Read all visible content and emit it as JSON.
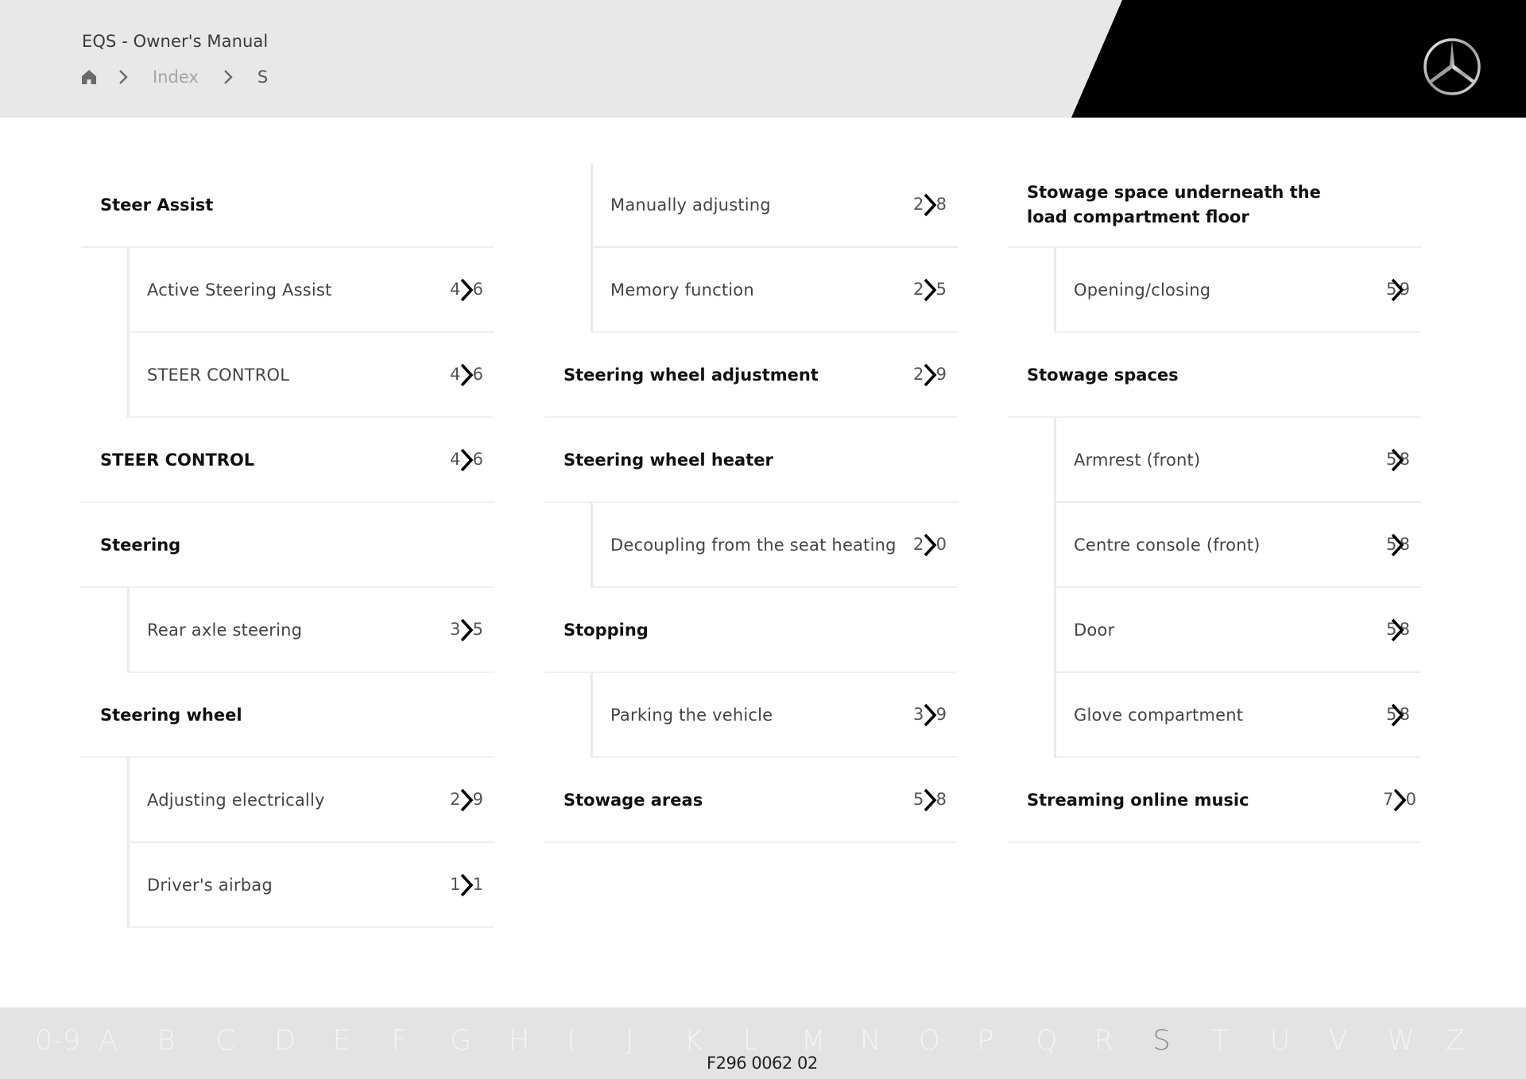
{
  "header": {
    "app_title": "EQS - Owner's Manual",
    "breadcrumb": {
      "home_icon": "home-icon",
      "items": [
        "Index",
        "S"
      ]
    },
    "logo": "mercedes-benz-star-logo"
  },
  "columns": [
    {
      "rows": [
        {
          "type": "top",
          "label": "Steer Assist"
        },
        {
          "type": "sub",
          "label": "Active Steering Assist",
          "page_first": "4",
          "page_last": "6"
        },
        {
          "type": "sub",
          "label": "STEER CONTROL",
          "page_first": "4",
          "page_last": "6"
        },
        {
          "type": "top",
          "label": "STEER CONTROL",
          "page_first": "4",
          "page_last": "6"
        },
        {
          "type": "top",
          "label": "Steering"
        },
        {
          "type": "sub",
          "label": "Rear axle steering",
          "page_first": "3",
          "page_last": "5"
        },
        {
          "type": "top",
          "label": "Steering wheel"
        },
        {
          "type": "sub",
          "label": "Adjusting electrically",
          "page_first": "2",
          "page_last": "9"
        },
        {
          "type": "sub",
          "label": "Driver's airbag",
          "page_first": "1",
          "page_last": "1"
        }
      ]
    },
    {
      "rows": [
        {
          "type": "sub",
          "label": "Manually adjusting",
          "page_first": "2",
          "page_last": "8"
        },
        {
          "type": "sub",
          "label": "Memory function",
          "page_first": "2",
          "page_last": "5"
        },
        {
          "type": "top",
          "label": "Steering wheel adjustment",
          "page_first": "2",
          "page_last": "9"
        },
        {
          "type": "top",
          "label": "Steering wheel heater"
        },
        {
          "type": "sub",
          "label": "Decoupling from the seat heating",
          "page_first": "2",
          "page_last": "0"
        },
        {
          "type": "top",
          "label": "Stopping"
        },
        {
          "type": "sub",
          "label": "Parking the vehicle",
          "page_first": "3",
          "page_last": "9"
        },
        {
          "type": "top",
          "label": "Stowage areas",
          "page_first": "5",
          "page_last": "8"
        }
      ]
    },
    {
      "rows": [
        {
          "type": "top",
          "label": "Stowage space underneath the load compartment floor"
        },
        {
          "type": "sub",
          "label": "Opening/closing",
          "page_first": "5",
          "page_last": "9"
        },
        {
          "type": "top",
          "label": "Stowage spaces"
        },
        {
          "type": "sub",
          "label": "Armrest (front)",
          "page_first": "5",
          "page_last": "8"
        },
        {
          "type": "sub",
          "label": "Centre console (front)",
          "page_first": "5",
          "page_last": "8"
        },
        {
          "type": "sub",
          "label": "Door",
          "page_first": "5",
          "page_last": "8"
        },
        {
          "type": "sub",
          "label": "Glove compartment",
          "page_first": "5",
          "page_last": "8"
        },
        {
          "type": "top",
          "label": "Streaming online music",
          "page_first": "7",
          "page_last": "0"
        }
      ]
    }
  ],
  "alphabet": {
    "items": [
      "0-9",
      "A",
      "B",
      "C",
      "D",
      "E",
      "F",
      "G",
      "H",
      "I",
      "J",
      "K",
      "L",
      "M",
      "N",
      "O",
      "P",
      "Q",
      "R",
      "S",
      "T",
      "U",
      "V",
      "W",
      "Z"
    ],
    "active": "S"
  },
  "doc_code": "F296 0062 02"
}
